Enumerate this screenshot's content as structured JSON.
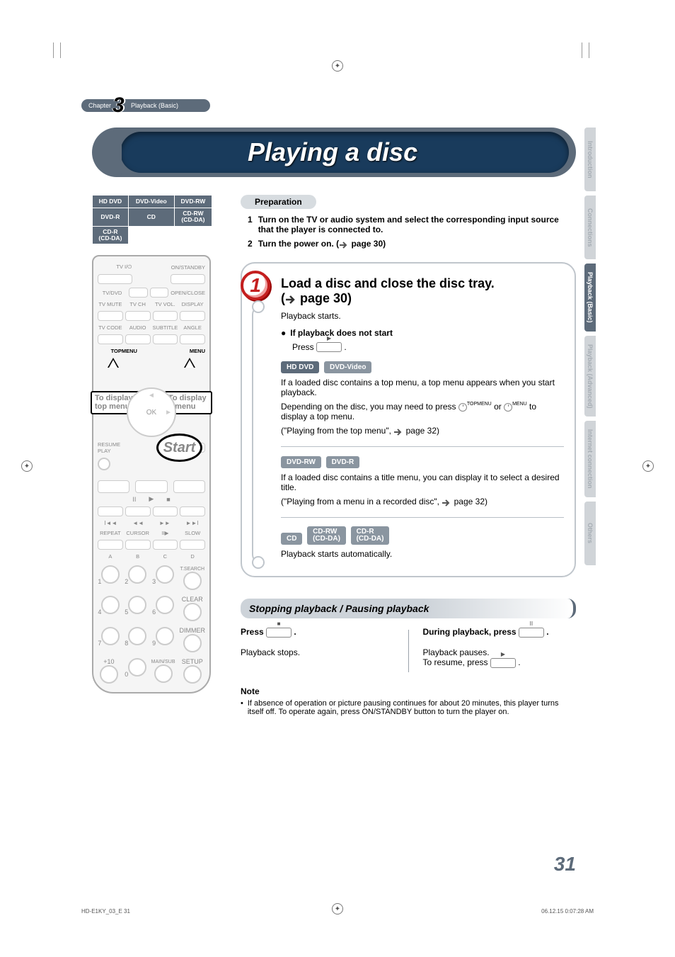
{
  "chapter": {
    "label": "Chapter",
    "number": "3",
    "section": "Playback (Basic)"
  },
  "title": "Playing a disc",
  "disc_table": {
    "r1": [
      "HD DVD",
      "DVD-Video",
      "DVD-RW"
    ],
    "r2": [
      "DVD-R",
      "CD",
      "CD-RW\n(CD-DA)"
    ],
    "r3": [
      "CD-R\n(CD-DA)"
    ]
  },
  "remote": {
    "row_labels": [
      "TV I/⏻",
      "ON/STANDBY"
    ],
    "topmenu": "TOPMENU",
    "menu": "MENU",
    "ok": "OK",
    "resume": "RESUME\nPLAY",
    "letters": [
      "A",
      "B",
      "C",
      "D"
    ],
    "bottom_labels": [
      "REPEAT",
      "CURSOR",
      "II▶",
      "SLOW"
    ],
    "numpad": [
      "1",
      "2",
      "3",
      "T.SEARCH",
      "4",
      "5",
      "6",
      "CLEAR",
      "7",
      "8",
      "9",
      "DIMMER",
      "+10",
      "0",
      "MAIN/SUB",
      "SETUP"
    ]
  },
  "callouts": {
    "left": "To display a top menu",
    "right": "To display a menu",
    "start": "Start"
  },
  "prep": {
    "heading": "Preparation",
    "items": [
      {
        "num": "1",
        "text": "Turn on the TV or audio system and select the corresponding input source that the player is connected to."
      },
      {
        "num": "2",
        "text_a": "Turn the power on. (",
        "text_b": " page 30)"
      }
    ]
  },
  "step1": {
    "num": "1",
    "heading_a": "Load a disc and close the disc tray.",
    "heading_b": "(",
    "heading_c": " page 30)",
    "line1": "Playback starts.",
    "bullet_title": "If playback does not start",
    "bullet_action_a": "Press",
    "bullet_action_b": ".",
    "tags1": [
      "HD DVD",
      "DVD-Video"
    ],
    "para1_a": "If a loaded disc contains a top menu, a top menu appears when you start playback.",
    "para1_b": "Depending on the disc, you may need to press",
    "para1_c": "or",
    "para1_d": "to display a top menu.",
    "para1_e": "(\"Playing from the top menu\",",
    "para1_f": " page 32)",
    "tags2": [
      "DVD-RW",
      "DVD-R"
    ],
    "para2_a": "If a loaded disc contains a title menu, you can display it to select a desired title.",
    "para2_b": "(\"Playing from a menu in a recorded disc\",",
    "para2_c": " page 32)",
    "tags3": [
      "CD",
      "CD-RW\n(CD-DA)",
      "CD-R\n(CD-DA)"
    ],
    "para3": "Playback starts automatically.",
    "icon_labels": {
      "topmenu": "TOPMENU",
      "menu": "MENU"
    }
  },
  "section2": {
    "heading": "Stopping playback / Pausing playback",
    "left_a": "Press",
    "left_b": ".",
    "left_c": "Playback stops.",
    "right_a": "During playback, press",
    "right_b": ".",
    "right_c": "Playback pauses.",
    "right_d": "To resume, press",
    "right_e": "."
  },
  "note": {
    "heading": "Note",
    "text": "If absence of operation or picture pausing continues for about 20 minutes, this player turns itself off. To operate again, press ON/STANDBY button to turn the player on."
  },
  "side_tabs": [
    "Introduction",
    "Connections",
    "Playback (Basic)",
    "Playback (Advanced)",
    "Internet connection",
    "Others"
  ],
  "page_number": "31",
  "footer": {
    "left": "HD-E1KY_03_E   31",
    "right": "06.12.15   0:07:28 AM"
  }
}
